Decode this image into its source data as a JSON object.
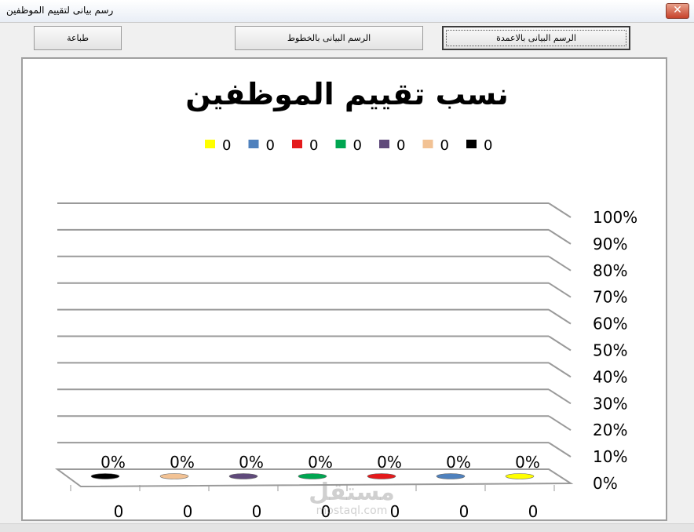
{
  "window": {
    "title": "رسم بيانى لتقييم الموظفين",
    "close_glyph": "✕"
  },
  "toolbar": {
    "print_label": "طباعة",
    "line_chart_label": "الرسم البيانى بالخطوط",
    "column_chart_label": "الرسم البيانى بالاعمدة"
  },
  "watermark": {
    "main": "مستقل",
    "sub": "mostaql.com"
  },
  "chart_data": {
    "type": "bar",
    "title": "نسب تقييم الموظفين",
    "categories": [
      "0",
      "0",
      "0",
      "0",
      "0",
      "0",
      "0"
    ],
    "series": [
      {
        "name": "0",
        "color": "#000000",
        "values": [
          0
        ]
      },
      {
        "name": "0",
        "color": "#f2c294",
        "values": [
          0
        ]
      },
      {
        "name": "0",
        "color": "#604a7b",
        "values": [
          0
        ]
      },
      {
        "name": "0",
        "color": "#00a651",
        "values": [
          0
        ]
      },
      {
        "name": "0",
        "color": "#e41a1c",
        "values": [
          0
        ]
      },
      {
        "name": "0",
        "color": "#4f81bd",
        "values": [
          0
        ]
      },
      {
        "name": "0",
        "color": "#ffff00",
        "values": [
          0
        ]
      }
    ],
    "values": [
      0,
      0,
      0,
      0,
      0,
      0,
      0
    ],
    "data_labels": [
      "0%",
      "0%",
      "0%",
      "0%",
      "0%",
      "0%",
      "0%"
    ],
    "y_ticks": [
      "0%",
      "10%",
      "20%",
      "30%",
      "40%",
      "50%",
      "60%",
      "70%",
      "80%",
      "90%",
      "100%"
    ],
    "ylim": [
      0,
      1
    ],
    "grid": true,
    "legend_position": "top",
    "legend_order": [
      6,
      5,
      4,
      3,
      2,
      1,
      0
    ]
  }
}
